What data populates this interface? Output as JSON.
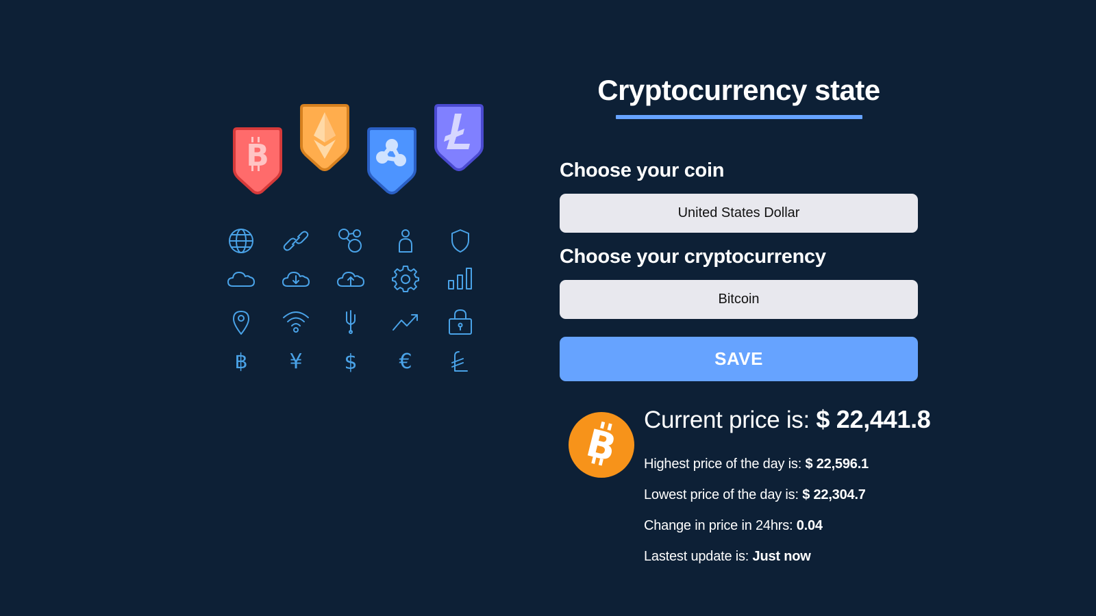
{
  "header": {
    "title": "Cryptocurrency state"
  },
  "form": {
    "coin_label": "Choose your coin",
    "coin_value": "United States Dollar",
    "crypto_label": "Choose your cryptocurrency",
    "crypto_value": "Bitcoin",
    "save_label": "SAVE"
  },
  "price": {
    "current_prefix": "Current price is: ",
    "current_value": "$ 22,441.8",
    "high_prefix": "Highest price of the day is: ",
    "high_value": "$ 22,596.1",
    "low_prefix": "Lowest price of the day is: ",
    "low_value": "$ 22,304.7",
    "change_prefix": "Change in price in 24hrs: ",
    "change_value": "0.04",
    "update_prefix": "Lastest update is: ",
    "update_value": "Just now",
    "coin_icon": "bitcoin-logo"
  },
  "illustration": {
    "shields": [
      "bitcoin-shield",
      "ethereum-shield",
      "ripple-shield",
      "litecoin-shield"
    ],
    "icons": [
      "globe-icon",
      "link-icon",
      "network-icon",
      "user-icon",
      "shield-icon",
      "cloud-icon",
      "cloud-download-icon",
      "cloud-upload-icon",
      "gear-icon",
      "bar-chart-icon",
      "map-pin-icon",
      "wifi-icon",
      "usb-icon",
      "trend-up-icon",
      "lock-icon",
      "bitcoin-symbol-icon",
      "yen-icon",
      "dollar-icon",
      "euro-icon",
      "litecoin-symbol-icon"
    ]
  },
  "colors": {
    "background": "#0d2036",
    "accent": "#66a3ff",
    "select_bg": "#e8e8ee",
    "bitcoin": "#f7931a",
    "icon_line": "#4aa3e8"
  }
}
